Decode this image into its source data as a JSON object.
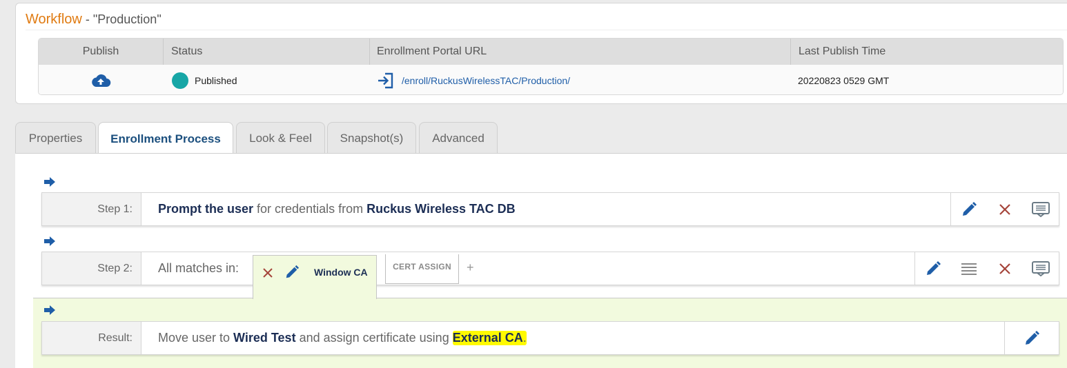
{
  "workflow": {
    "title_word": "Workflow",
    "title_sep": " - ",
    "name": "\"Production\""
  },
  "publish_table": {
    "headers": [
      "Publish",
      "Status",
      "Enrollment Portal URL",
      "Last Publish Time"
    ],
    "publish_icon": "cloud-upload-icon",
    "status": "Published",
    "status_color": "#17a6a6",
    "portal_url": "/enroll/RuckusWirelessTAC/Production/",
    "last_publish_time": "20220823 0529 GMT"
  },
  "tabs": [
    {
      "label": "Properties",
      "active": false
    },
    {
      "label": "Enrollment Process",
      "active": true
    },
    {
      "label": "Look & Feel",
      "active": false
    },
    {
      "label": "Snapshot(s)",
      "active": false
    },
    {
      "label": "Advanced",
      "active": false
    }
  ],
  "steps": {
    "step1": {
      "label": "Step 1:",
      "t1": "Prompt the user",
      "t2": " for credentials from ",
      "t3": "Ruckus Wireless TAC DB"
    },
    "step2": {
      "label": "Step 2:",
      "text": "All matches in:",
      "ca_name": "Window CA",
      "cert_tab": "CERT ASSIGN",
      "add": "+"
    },
    "result": {
      "label": "Result:",
      "t1": "Move user to ",
      "t2": "Wired Test",
      "t3": " and assign certificate using ",
      "t4": "External CA",
      "t5": "."
    }
  },
  "colors": {
    "accent_orange": "#e07b12",
    "primary_blue": "#1f5ea8",
    "delete_red": "#a5443a",
    "highlight_yellow": "#fffa00",
    "result_bg": "#f2fade"
  }
}
